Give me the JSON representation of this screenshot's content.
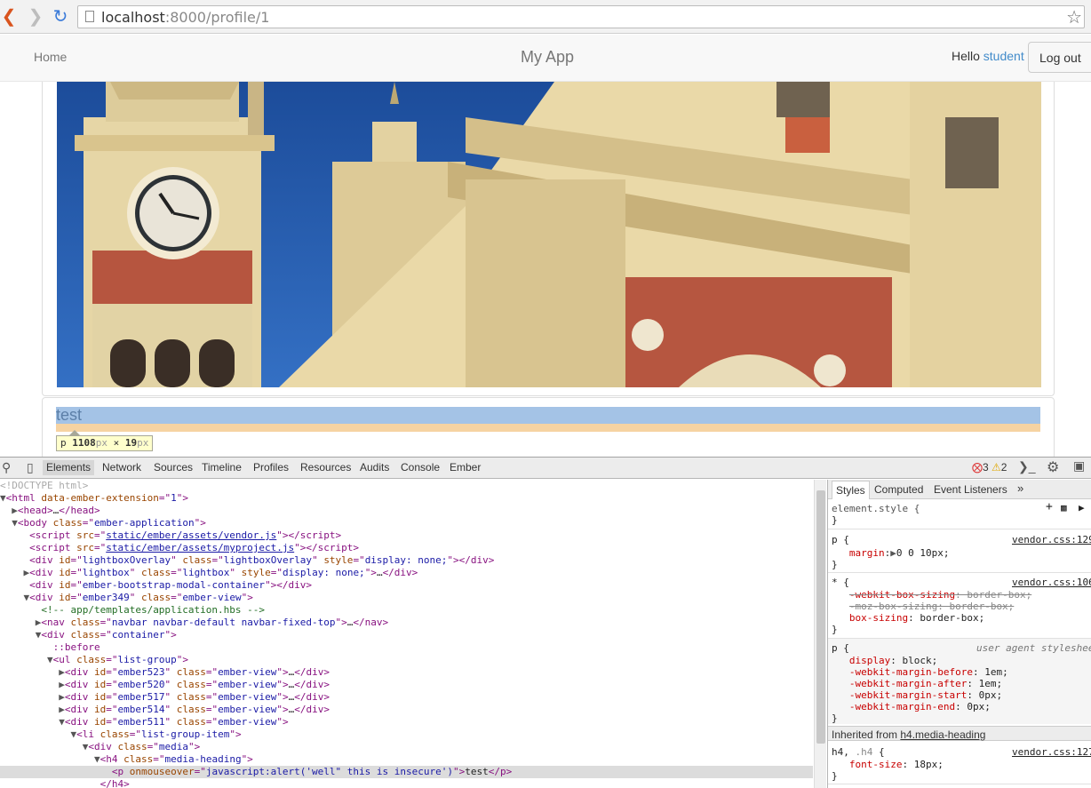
{
  "browser": {
    "url_host": "localhost",
    "url_path": ":8000/profile/1"
  },
  "navbar": {
    "home": "Home",
    "brand": "My App",
    "hello": "Hello ",
    "username": "student",
    "logout": "Log out"
  },
  "content": {
    "test_text": "test",
    "tooltip_tag": "p",
    "tooltip_width": "1108",
    "tooltip_px1": "px",
    "tooltip_times": " × ",
    "tooltip_height": "19",
    "tooltip_px2": "px"
  },
  "devtools": {
    "tabs": [
      "Elements",
      "Network",
      "Sources",
      "Timeline",
      "Profiles",
      "Resources",
      "Audits",
      "Console",
      "Ember"
    ],
    "error_count": "3",
    "warning_count": "2",
    "styles_tabs": [
      "Styles",
      "Computed",
      "Event Listeners",
      "»"
    ],
    "inherited_label": "Inherited from ",
    "inherited_from": "h4.media-heading",
    "colors": {
      "tag": "#881280",
      "attr": "#994500",
      "value": "#1a1aa6",
      "comment": "#236e25",
      "property": "#c80000"
    }
  }
}
